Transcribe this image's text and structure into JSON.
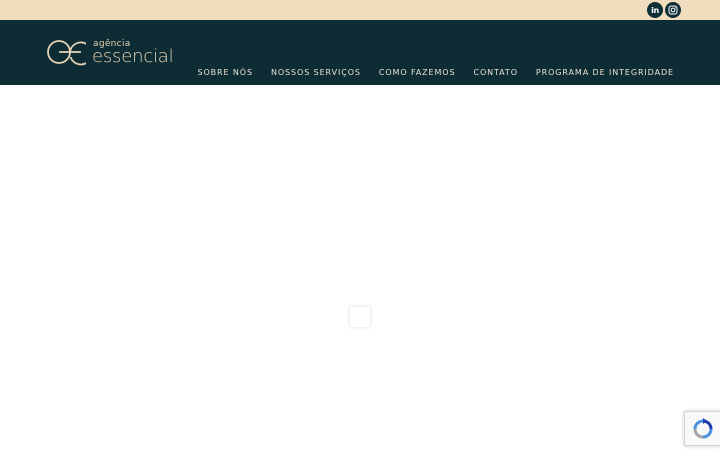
{
  "topbar": {
    "social": [
      {
        "name": "linkedin-icon",
        "label": "in"
      },
      {
        "name": "instagram-icon"
      }
    ]
  },
  "brand": {
    "small": "agência",
    "big": "essencial"
  },
  "nav": [
    {
      "label": "SOBRE NÓS"
    },
    {
      "label": "NOSSOS SERVIÇOS"
    },
    {
      "label": "COMO FAZEMOS"
    },
    {
      "label": "CONTATO"
    },
    {
      "label": "PROGRAMA DE INTEGRIDADE"
    }
  ],
  "colors": {
    "topbar_bg": "#f1dcbd",
    "header_bg": "#0d2c33",
    "brand_text": "#e6d3b5",
    "icon_bg": "#0e2f37"
  }
}
